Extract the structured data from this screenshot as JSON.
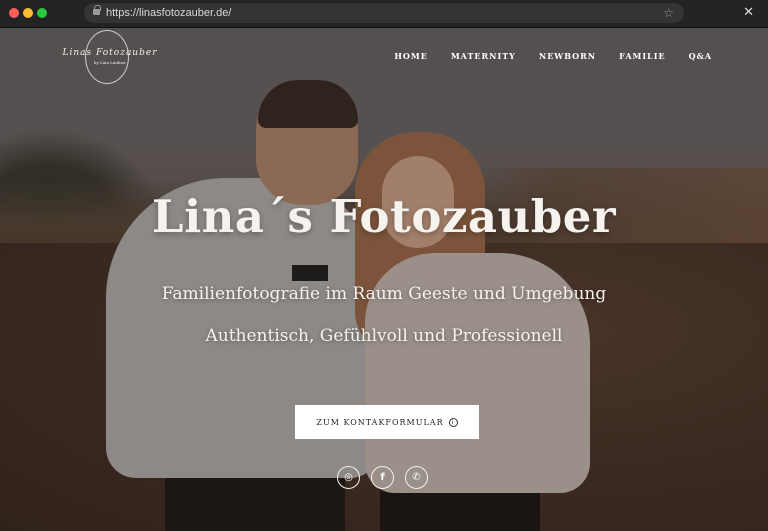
{
  "browser": {
    "url": "https://linasfotozauber.de/",
    "star_icon": "☆",
    "close_icon": "✕"
  },
  "logo": {
    "text": "Linas Fotozauber",
    "subtext": "by Lina Lindner"
  },
  "nav": {
    "items": [
      {
        "label": "HOME"
      },
      {
        "label": "MATERNITY"
      },
      {
        "label": "NEWBORN"
      },
      {
        "label": "FAMILIE"
      },
      {
        "label": "Q&A"
      }
    ]
  },
  "hero": {
    "title": "Lina´s Fotozauber",
    "subtitle": "Familienfotografie im Raum Geeste und Umgebung",
    "tagline": "Authentisch, Gefühlvoll und Professionell",
    "cta_label": "ZUM KONTAKFORMULAR",
    "cta_icon": "i"
  },
  "socials": [
    {
      "name": "instagram-icon",
      "glyph": "◎"
    },
    {
      "name": "facebook-icon",
      "glyph": "f"
    },
    {
      "name": "whatsapp-icon",
      "glyph": "✆"
    }
  ]
}
